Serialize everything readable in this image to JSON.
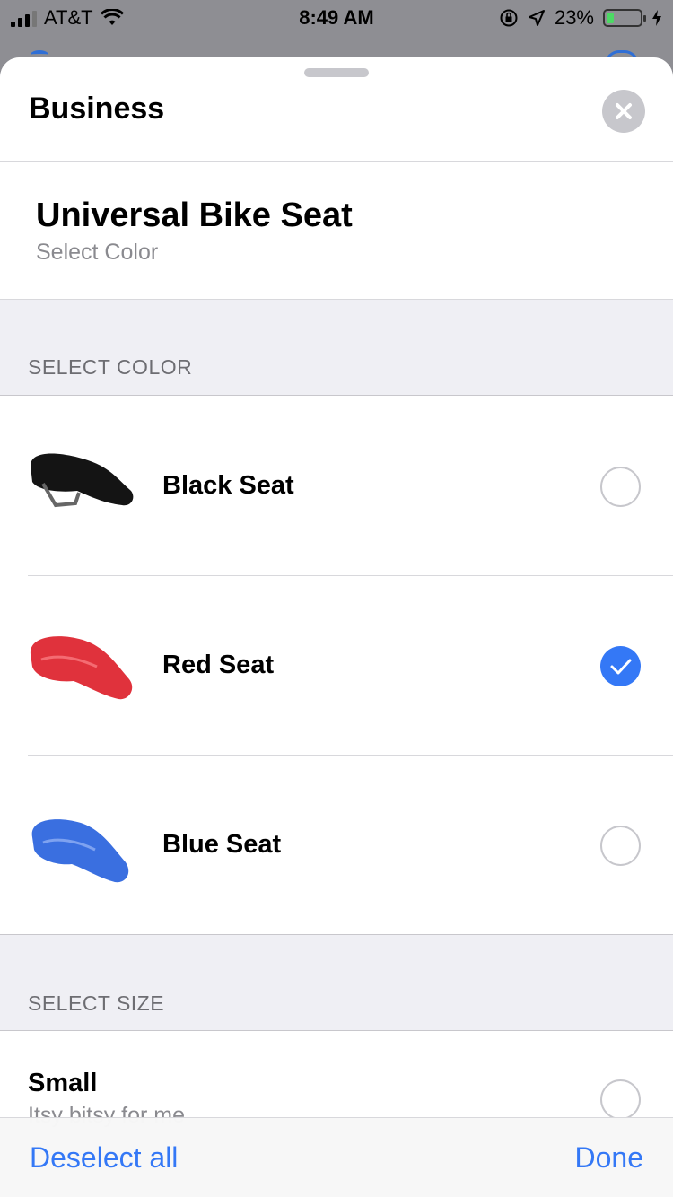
{
  "status_bar": {
    "carrier": "AT&T",
    "time": "8:49 AM",
    "battery_percent": "23%",
    "battery_level": 0.23
  },
  "sheet": {
    "title": "Business"
  },
  "product": {
    "name": "Universal Bike Seat",
    "subtitle": "Select Color"
  },
  "color_section": {
    "header": "SELECT COLOR",
    "options": [
      {
        "label": "Black Seat",
        "color": "#141414",
        "selected": false
      },
      {
        "label": "Red Seat",
        "color": "#e0323c",
        "selected": true
      },
      {
        "label": "Blue Seat",
        "color": "#3a6fe0",
        "selected": false
      }
    ]
  },
  "size_section": {
    "header": "SELECT SIZE",
    "options": [
      {
        "label": "Small",
        "subtitle": "Itsy bitsy for me",
        "selected": false
      }
    ]
  },
  "bottom_bar": {
    "left_label": "Deselect all",
    "right_label": "Done"
  },
  "colors": {
    "accent": "#3478f6",
    "battery": "#4cd964"
  }
}
